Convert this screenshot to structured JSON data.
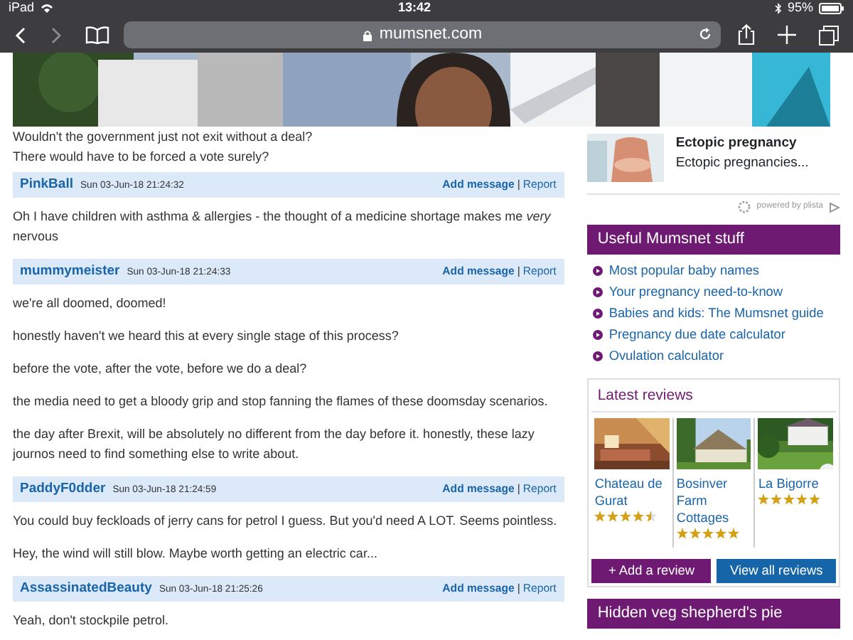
{
  "status_bar": {
    "device": "iPad",
    "time": "13:42",
    "battery": "95%"
  },
  "toolbar": {
    "nav": [
      {
        "kind": "back",
        "disabled": false
      },
      {
        "kind": "forward",
        "disabled": true
      }
    ],
    "url": "mumsnet.com"
  },
  "thread": {
    "continuation": [
      "Wouldn't the government just not exit without a deal?",
      "There would have to be forced a vote surely?"
    ],
    "posts": [
      {
        "author": "PinkBall",
        "date": "Sun 03-Jun-18 21:24:32",
        "add_label": "Add message",
        "separator": "|",
        "report_label": "Report",
        "paragraphs": [
          "Oh I have children with asthma & allergies - the thought of a medicine shortage makes me *very* nervous"
        ]
      },
      {
        "author": "mummymeister",
        "date": "Sun 03-Jun-18 21:24:33",
        "add_label": "Add message",
        "separator": "|",
        "report_label": "Report",
        "paragraphs": [
          "we're all doomed, doomed!",
          "honestly haven't we heard this at every single stage of this process?",
          "before the vote, after the vote, before we do a deal?",
          "the media need to get a bloody grip and stop fanning the flames of these doomsday scenarios.",
          "the day after Brexit, will be absolutely no different from the day before it. honestly, these lazy journos need to find something else to write about."
        ]
      },
      {
        "author": "PaddyF0dder",
        "date": "Sun 03-Jun-18 21:24:59",
        "add_label": "Add message",
        "separator": "|",
        "report_label": "Report",
        "paragraphs": [
          "You could buy feckloads of jerry cans for petrol I guess. But you'd need A LOT. Seems pointless.",
          "Hey, the wind will still blow. Maybe worth getting an electric car..."
        ]
      },
      {
        "author": "AssassinatedBeauty",
        "date": "Sun 03-Jun-18 21:25:26",
        "add_label": "Add message",
        "separator": "|",
        "report_label": "Report",
        "paragraphs": [
          "Yeah, don't stockpile petrol."
        ]
      }
    ]
  },
  "sidebar": {
    "recommendation": {
      "title": "Ectopic pregnancy",
      "snippet": "Ectopic pregnancies...",
      "credit": "powered by plista"
    },
    "useful": {
      "title": "Useful Mumsnet stuff",
      "links": [
        "Most popular baby names",
        "Your pregnancy need-to-know",
        "Babies and kids: The Mumsnet guide",
        "Pregnancy due date calculator",
        "Ovulation calculator"
      ]
    },
    "reviews": {
      "title": "Latest reviews",
      "items": [
        {
          "name": "Chateau de Gurat",
          "stars": 4.5
        },
        {
          "name": "Bosinver Farm Cottages",
          "stars": 5
        },
        {
          "name": "La Bigorre",
          "stars": 5
        }
      ],
      "buttons": [
        {
          "label": "+ Add a review",
          "kind": "purple"
        },
        {
          "label": "View all reviews",
          "kind": "blue"
        }
      ]
    },
    "next_heading": "Hidden veg shepherd's pie"
  }
}
